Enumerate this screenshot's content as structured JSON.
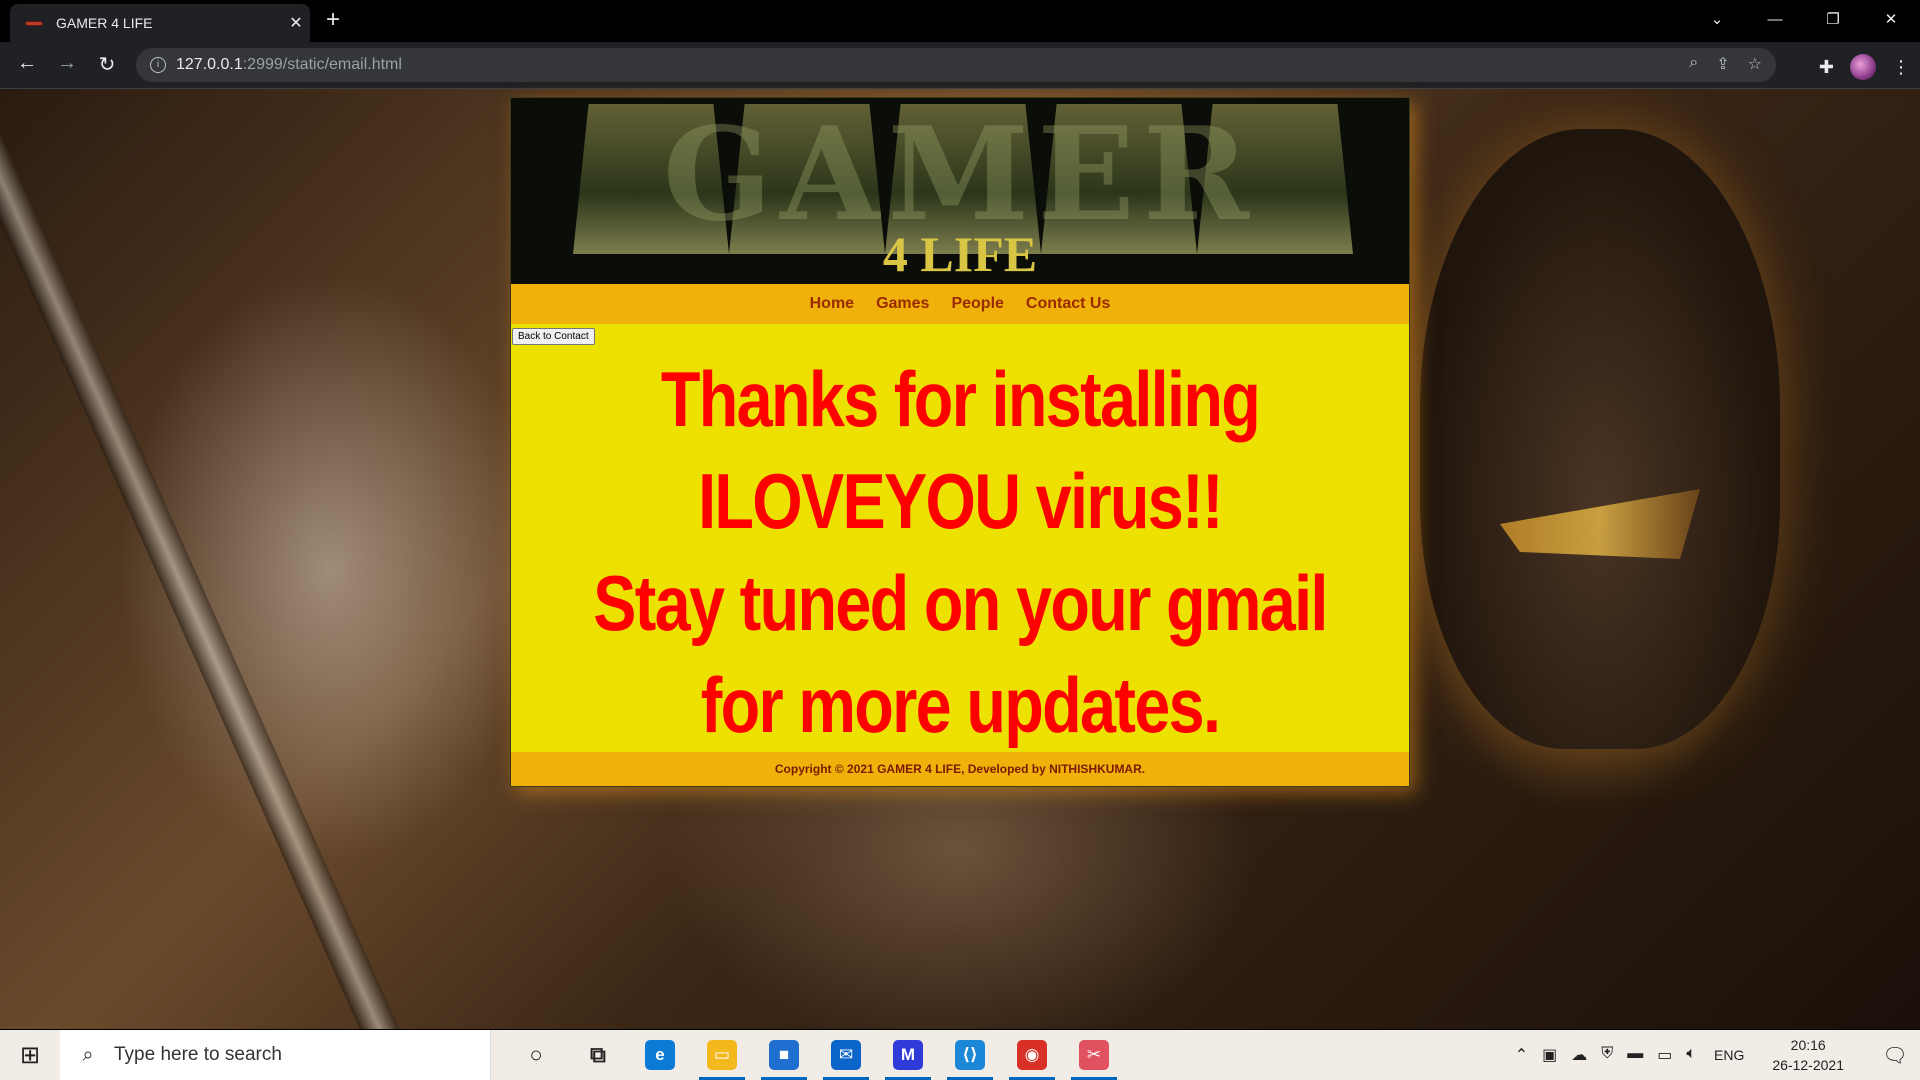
{
  "browser": {
    "tab_title": "GAMER 4 LIFE",
    "tab_close": "✕",
    "new_tab": "+",
    "url_host": "127.0.0.1",
    "url_path": ":2999/static/email.html",
    "window_controls": {
      "dropdown": "⌄",
      "minimize": "—",
      "restore": "❐",
      "close": "✕"
    }
  },
  "site": {
    "banner_title": "GAMER",
    "banner_subtitle": "4 LIFE",
    "nav": [
      "Home",
      "Games",
      "People",
      "Contact Us"
    ],
    "back_button": "Back to Contact",
    "message_lines": [
      "Thanks for installing",
      "ILOVEYOU virus!!",
      "Stay tuned on your gmail",
      "for more updates."
    ],
    "footer": "Copyright © 2021 GAMER 4 LIFE, Developed by NITHISHKUMAR."
  },
  "taskbar": {
    "search_placeholder": "Type here to search",
    "apps": [
      {
        "name": "cortana",
        "glyph": "○",
        "color": "#222222"
      },
      {
        "name": "task-view",
        "glyph": "⧉",
        "color": "#222222"
      },
      {
        "name": "edge",
        "glyph": "e",
        "color": "#0c7bd6"
      },
      {
        "name": "file-explorer",
        "glyph": "▭",
        "color": "#f2b81c"
      },
      {
        "name": "store",
        "glyph": "■",
        "color": "#1f6fd1"
      },
      {
        "name": "mail",
        "glyph": "✉",
        "color": "#0a64c9"
      },
      {
        "name": "app-m",
        "glyph": "M",
        "color": "#2f3bd8"
      },
      {
        "name": "vscode",
        "glyph": "⟨⟩",
        "color": "#1b87d6"
      },
      {
        "name": "chrome",
        "glyph": "◉",
        "color": "#d93025"
      },
      {
        "name": "snipping",
        "glyph": "✂",
        "color": "#e05260"
      }
    ],
    "language": "ENG",
    "time": "20:16",
    "date": "26-12-2021"
  },
  "colors": {
    "accent_orange": "#f0b20a",
    "page_yellow": "#ece100",
    "message_red": "#ff0000",
    "nav_text": "#9a2a00"
  }
}
